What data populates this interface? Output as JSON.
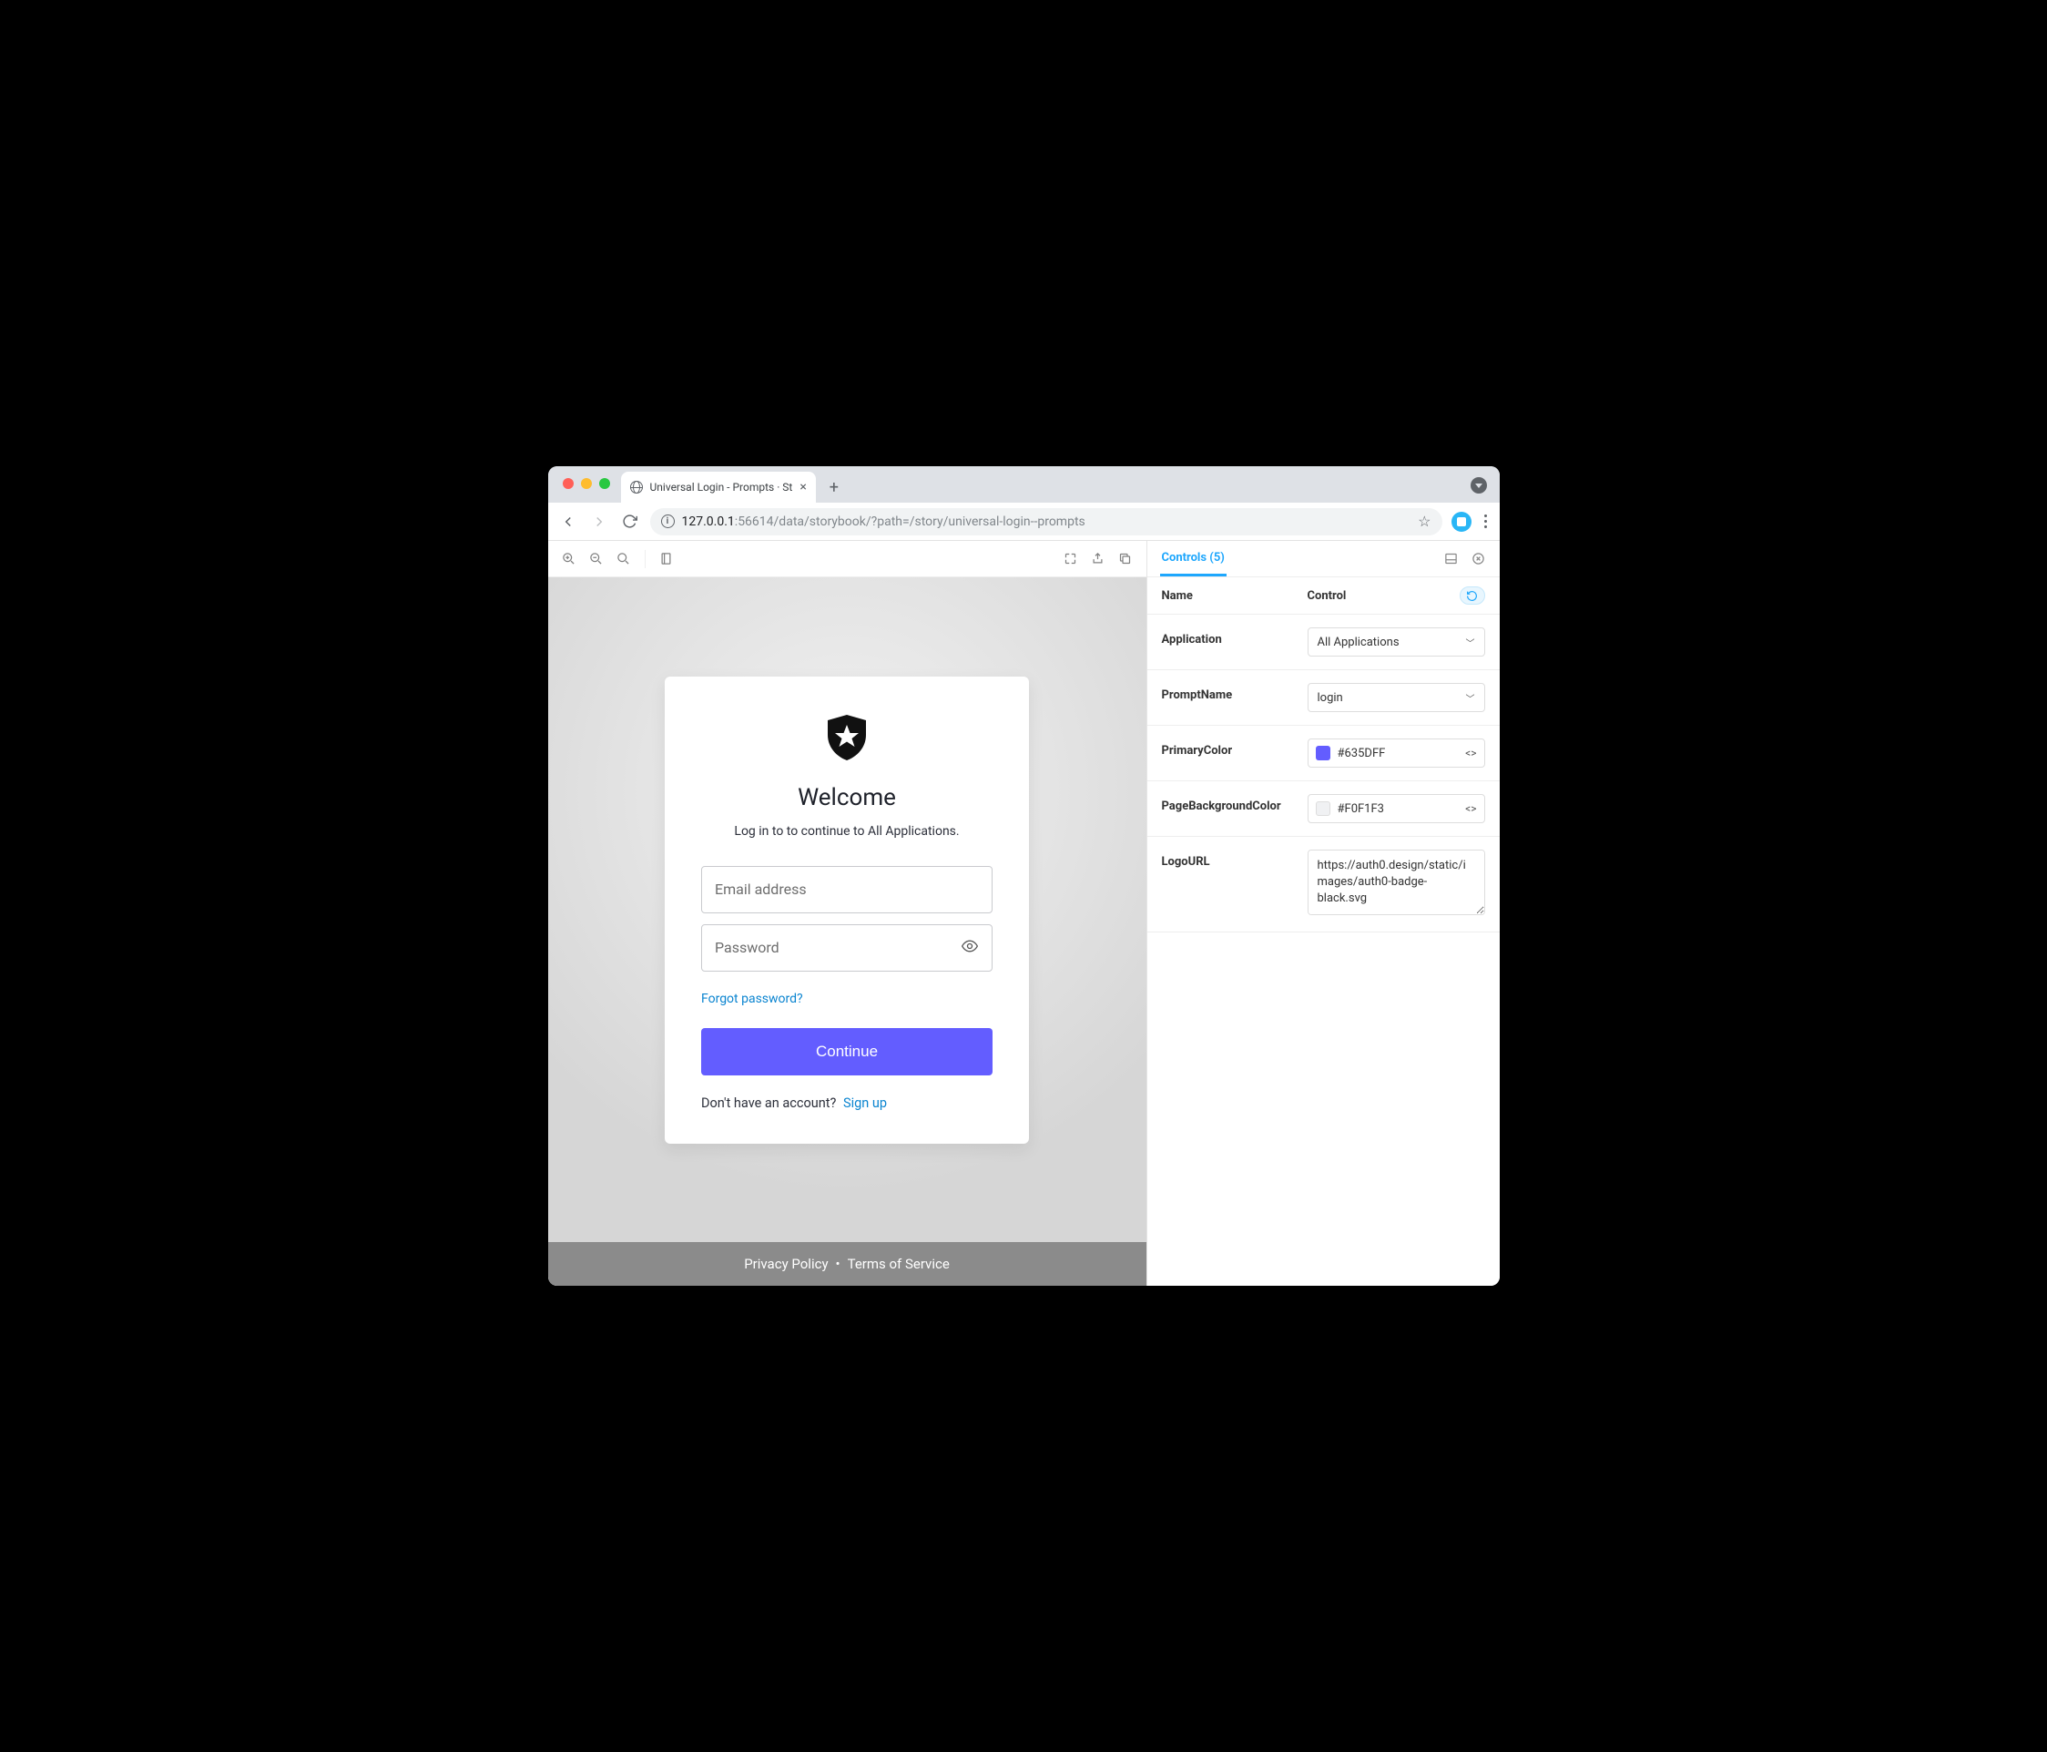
{
  "browser": {
    "tab_title": "Universal Login - Prompts · St",
    "url_prefix": "127.0.0.1",
    "url_rest": ":56614/data/storybook/?path=/story/universal-login--prompts"
  },
  "login": {
    "welcome": "Welcome",
    "subtitle": "Log in to to continue to All Applications.",
    "email_placeholder": "Email address",
    "password_placeholder": "Password",
    "forgot": "Forgot password?",
    "continue": "Continue",
    "nohave": "Don't have an account?",
    "signup": "Sign up",
    "footer_privacy": "Privacy Policy",
    "footer_sep": "•",
    "footer_tos": "Terms of Service"
  },
  "addons": {
    "tab_label": "Controls (5)",
    "head_name": "Name",
    "head_control": "Control",
    "controls": {
      "application": {
        "name": "Application",
        "value": "All Applications"
      },
      "promptName": {
        "name": "PromptName",
        "value": "login"
      },
      "primaryColor": {
        "name": "PrimaryColor",
        "value": "#635DFF"
      },
      "pageBackgroundColor": {
        "name": "PageBackgroundColor",
        "value": "#F0F1F3"
      },
      "logoURL": {
        "name": "LogoURL",
        "value": "https://auth0.design/static/images/auth0-badge-black.svg"
      }
    }
  }
}
